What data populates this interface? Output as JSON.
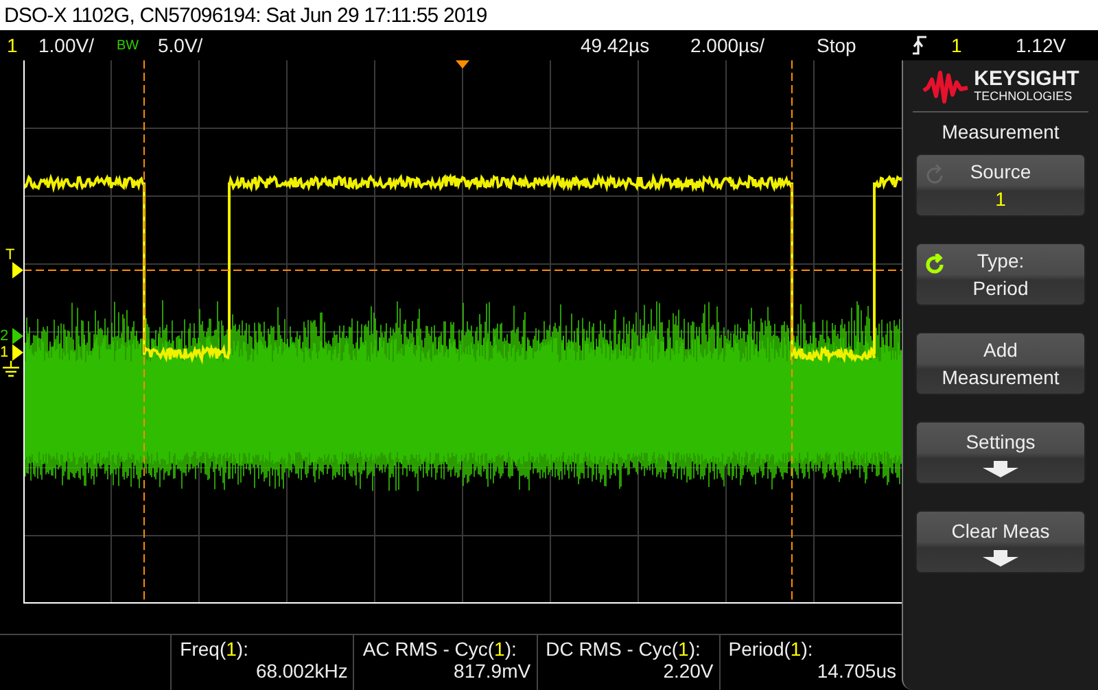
{
  "window": {
    "title": "DSO-X 1102G, CN57096194: Sat Jun 29 17:11:55 2019"
  },
  "status_bar": {
    "channel_1": {
      "number": "1",
      "scale": "1.00V/"
    },
    "bw_label": "BW",
    "channel_2_scale": "5.0V/",
    "delay": "49.42µs",
    "timebase": "2.000µs/",
    "run_state": "Stop",
    "trigger": {
      "source": "1",
      "level": "1.12V"
    }
  },
  "level_markers": [
    {
      "label": "T",
      "color": "#ffff00"
    },
    {
      "label": "2",
      "color": "#33cc00"
    },
    {
      "label": "1",
      "color": "#ffff00"
    }
  ],
  "panel": {
    "brand": "KEYSIGHT",
    "brand_sub": "TECHNOLOGIES",
    "title": "Measurement",
    "softkeys": [
      {
        "lines": [
          "Source"
        ],
        "channel": "1",
        "knob": true,
        "knob_active": false,
        "submenu": false
      },
      {
        "lines": [
          "Type:",
          "Period"
        ],
        "knob": true,
        "knob_active": true,
        "submenu": false
      },
      {
        "lines": [
          "Add",
          "Measurement"
        ],
        "knob": false,
        "submenu": false
      },
      {
        "lines": [
          "Settings"
        ],
        "knob": false,
        "submenu": true
      },
      {
        "lines": [
          "Clear Meas"
        ],
        "knob": false,
        "submenu": true
      }
    ]
  },
  "measurements": [
    {
      "prefix": "Freq(",
      "source": "1",
      "suffix": "):",
      "value": "68.002kHz"
    },
    {
      "prefix": "AC RMS - Cyc(",
      "source": "1",
      "suffix": "):",
      "value": "817.9mV"
    },
    {
      "prefix": "DC RMS - Cyc(",
      "source": "1",
      "suffix": "):",
      "value": "2.20V"
    },
    {
      "prefix": "Period(",
      "source": "1",
      "suffix": "):",
      "value": "14.705us"
    }
  ]
}
